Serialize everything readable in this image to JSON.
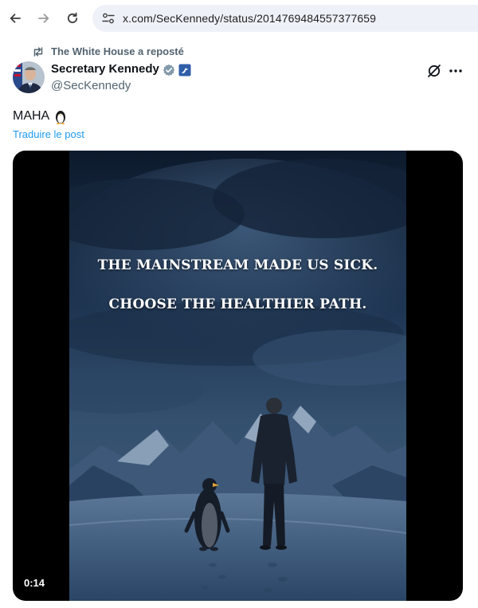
{
  "browser": {
    "url": "x.com/SecKennedy/status/2014769484557377659"
  },
  "post": {
    "repost_label": "The White House a reposté",
    "author_name": "Secretary Kennedy",
    "author_handle": "@SecKennedy",
    "text": "MAHA",
    "text_emoji": "penguin-emoji",
    "translate_label": "Traduire le post",
    "media": {
      "caption_line1": "THE MAINSTREAM MADE US SICK.",
      "caption_line2": "CHOOSE THE HEALTHIER PATH.",
      "duration": "0:14"
    }
  },
  "colors": {
    "link": "#1d9bf0",
    "muted": "#536471",
    "verified": "#829aab"
  }
}
